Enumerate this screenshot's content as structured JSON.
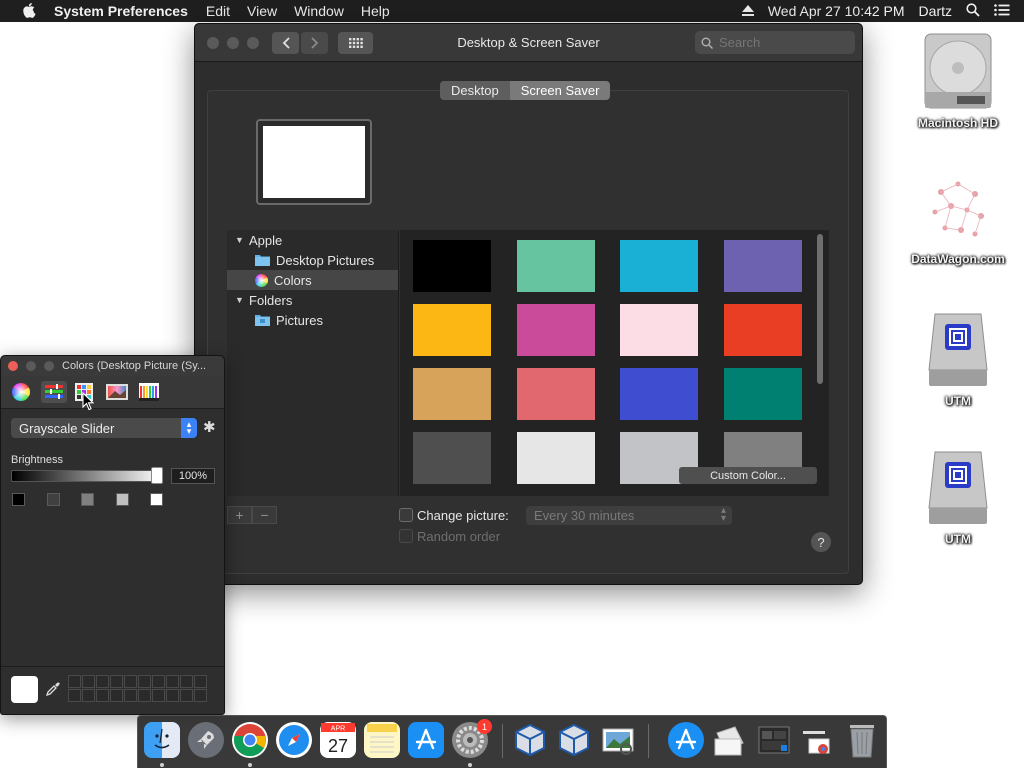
{
  "menubar": {
    "app_name": "System Preferences",
    "items": [
      "Edit",
      "View",
      "Window",
      "Help"
    ],
    "datetime": "Wed Apr 27  10:42 PM",
    "user": "Dartz"
  },
  "desktop": {
    "icons": [
      {
        "label": "Macintosh HD",
        "icon": "hard-drive-icon"
      },
      {
        "label": "DataWagon.com",
        "icon": "datawagon-icon"
      },
      {
        "label": "UTM",
        "icon": "utm-drive-icon"
      },
      {
        "label": "UTM",
        "icon": "utm-drive-icon"
      }
    ]
  },
  "window": {
    "title": "Desktop & Screen Saver",
    "search_placeholder": "Search",
    "tabs": [
      "Desktop",
      "Screen Saver"
    ],
    "selected_tab": "Screen Saver",
    "sidebar": {
      "apple_group": "Apple",
      "desktop_pictures": "Desktop Pictures",
      "colors": "Colors",
      "folders_group": "Folders",
      "pictures": "Pictures"
    },
    "swatches": [
      "#000000",
      "#67c4a0",
      "#1aafd4",
      "#6c62b0",
      "#fcb714",
      "#cb4b9b",
      "#fcdde6",
      "#ea3e24",
      "#d7a35a",
      "#e1686f",
      "#3f4ed1",
      "#008071",
      "#4f4f4f",
      "#e6e6e6",
      "#c1c3c6",
      "#808080"
    ],
    "custom_color_label": "Custom Color...",
    "change_picture_label": "Change picture:",
    "interval": "Every 30 minutes",
    "random_order_label": "Random order",
    "help": "?"
  },
  "colors_panel": {
    "title": "Colors (Desktop Picture (Sy...",
    "mode": "Grayscale Slider",
    "brightness_label": "Brightness",
    "brightness_value": "100%",
    "brightness_fraction": 1.0,
    "presets": [
      "#000000",
      "#404040",
      "#808080",
      "#c0c0c0",
      "#ffffff"
    ]
  },
  "dock": {
    "apps": [
      "finder-icon",
      "launchpad-icon",
      "chrome-icon",
      "safari-icon",
      "calendar-icon",
      "notes-icon",
      "app-store-icon",
      "system-preferences-icon",
      "virtualbox-icon",
      "virtualbox-vm-icon",
      "preview-icon",
      "app-store-folder-icon",
      "documents-icon",
      "screenshots-icon",
      "chrome-folder-icon",
      "trash-icon"
    ],
    "calendar_month": "APR",
    "calendar_day": "27",
    "badge": "1"
  }
}
